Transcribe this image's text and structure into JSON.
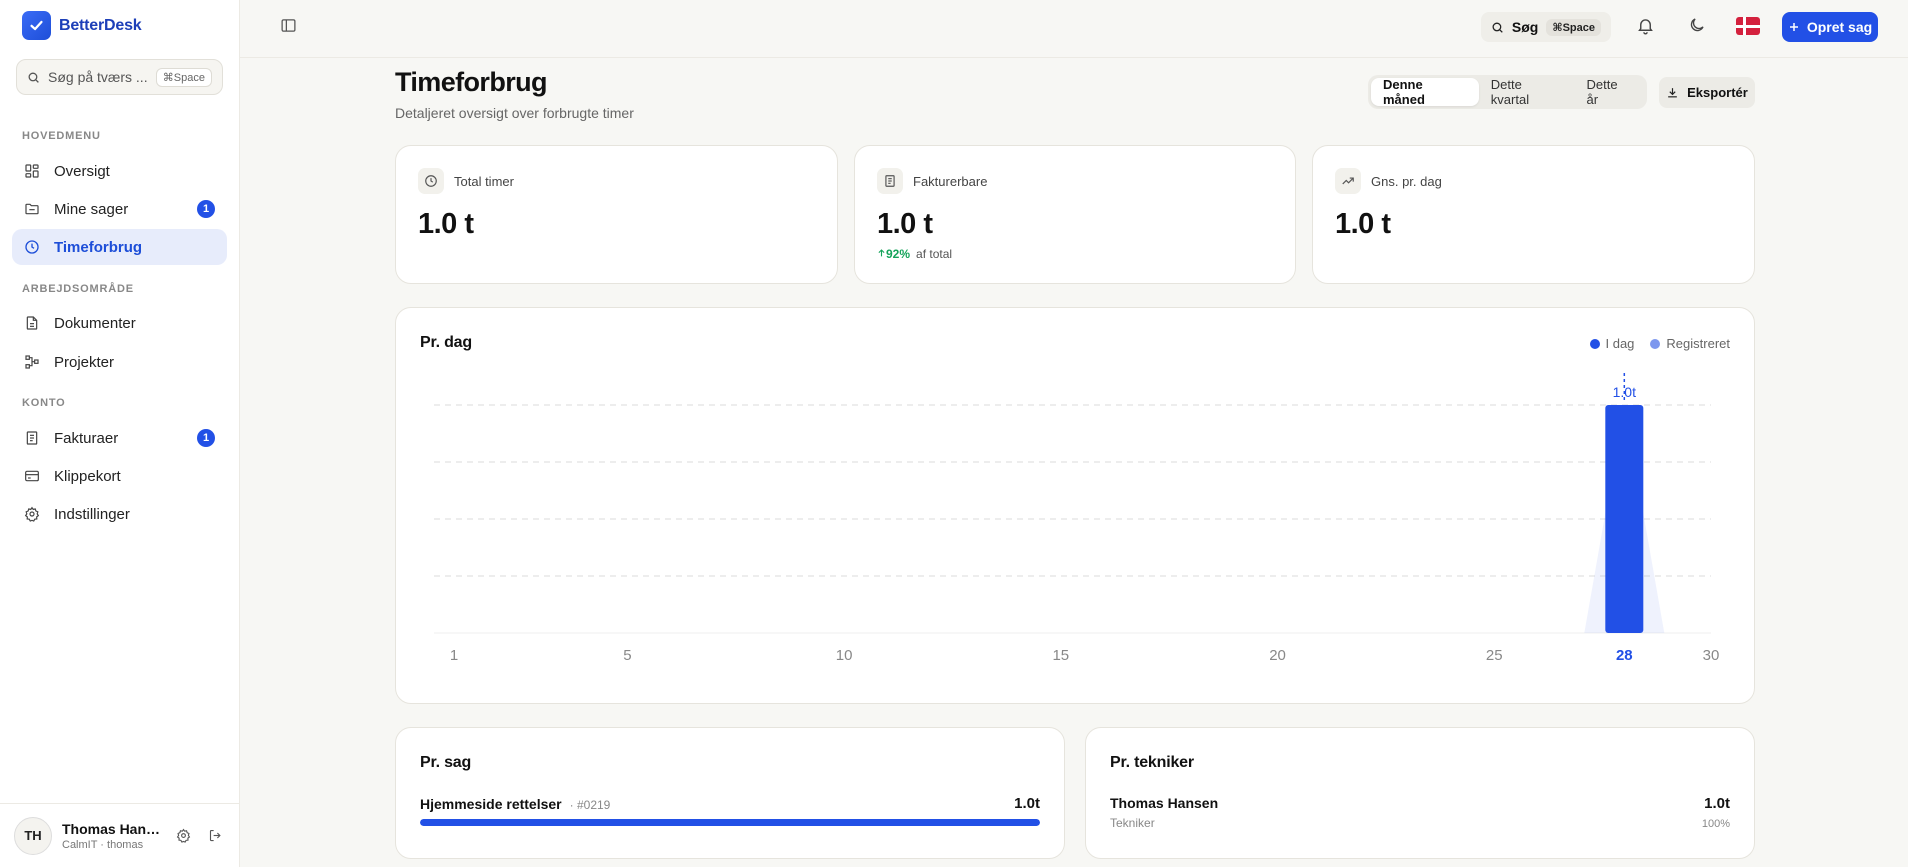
{
  "app": {
    "name": "BetterDesk"
  },
  "sidebar": {
    "search": {
      "placeholder": "Søg på tværs ...",
      "shortcut": "⌘Space"
    },
    "sections": [
      {
        "label": "HOVEDMENU",
        "items": [
          {
            "label": "Oversigt",
            "icon": "grid-icon"
          },
          {
            "label": "Mine sager",
            "icon": "folder-icon",
            "badge": "1"
          },
          {
            "label": "Timeforbrug",
            "icon": "clock-icon",
            "active": true
          }
        ]
      },
      {
        "label": "ARBEJDSOMRÅDE",
        "items": [
          {
            "label": "Dokumenter",
            "icon": "document-icon"
          },
          {
            "label": "Projekter",
            "icon": "workflow-icon"
          }
        ]
      },
      {
        "label": "KONTO",
        "items": [
          {
            "label": "Fakturaer",
            "icon": "invoice-icon",
            "badge": "1"
          },
          {
            "label": "Klippekort",
            "icon": "card-icon"
          },
          {
            "label": "Indstillinger",
            "icon": "gear-icon"
          }
        ]
      }
    ],
    "user": {
      "initials": "TH",
      "name": "Thomas Hans...",
      "sub": "CalmIT · thomas"
    }
  },
  "topbar": {
    "search_label": "Søg",
    "search_shortcut": "⌘Space",
    "create_label": "Opret sag"
  },
  "page": {
    "title": "Timeforbrug",
    "subtitle": "Detaljeret oversigt over forbrugte timer",
    "periods": [
      "Denne måned",
      "Dette kvartal",
      "Dette år"
    ],
    "active_period": 0,
    "export_label": "Eksportér"
  },
  "stats": [
    {
      "label": "Total timer",
      "value": "1.0 t",
      "icon": "clock-icon"
    },
    {
      "label": "Fakturerbare",
      "value": "1.0 t",
      "icon": "receipt-icon",
      "meta_up": "92%",
      "meta_text": "af total"
    },
    {
      "label": "Gns. pr. dag",
      "value": "1.0 t",
      "icon": "trend-up-icon"
    }
  ],
  "per_day": {
    "title": "Pr. dag",
    "legend": [
      "I dag",
      "Registreret"
    ]
  },
  "chart_data": {
    "type": "bar",
    "x": [
      28
    ],
    "values": [
      1.0
    ],
    "value_labels": [
      "1.0t"
    ],
    "xticks": [
      "1",
      "5",
      "10",
      "15",
      "20",
      "25",
      "28",
      "30"
    ],
    "xlim": [
      1,
      30
    ],
    "ylim": [
      0,
      1.0
    ],
    "highlight_x": 28,
    "grid": true,
    "legend_placement": "top-right",
    "colors": {
      "today": "#2250e6",
      "registered": "#7d97ee"
    }
  },
  "per_case": {
    "title": "Pr. sag",
    "items": [
      {
        "name": "Hjemmeside rettelser",
        "id": "· #0219",
        "value": "1.0t",
        "fraction": 1.0
      }
    ]
  },
  "per_tech": {
    "title": "Pr. tekniker",
    "items": [
      {
        "name": "Thomas Hansen",
        "role": "Tekniker",
        "value": "1.0t",
        "pct": "100%"
      }
    ]
  }
}
